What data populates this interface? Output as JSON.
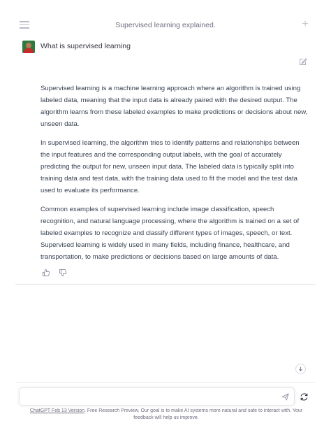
{
  "header": {
    "title": "Supervised learning explained.",
    "menu_icon": "hamburger-menu-icon",
    "new_chat_icon": "plus-icon"
  },
  "user": {
    "avatar_icon": "user-avatar",
    "message": "What is supervised learning"
  },
  "assistant": {
    "paragraphs": [
      "Supervised learning is a machine learning approach where an algorithm is trained using labeled data, meaning that the input data is already paired with the desired output. The algorithm learns from these labeled examples to make predictions or decisions about new, unseen data.",
      "In supervised learning, the algorithm tries to identify patterns and relationships between the input features and the corresponding output labels, with the goal of accurately predicting the output for new, unseen input data. The labeled data is typically split into training data and test data, with the training data used to fit the model and the test data used to evaluate its performance.",
      "Common examples of supervised learning include image classification, speech recognition, and natural language processing, where the algorithm is trained on a set of labeled examples to recognize and classify different types of images, speech, or text. Supervised learning is widely used in many fields, including finance, healthcare, and transportation, to make predictions or decisions based on large amounts of data."
    ]
  },
  "input": {
    "value": "",
    "placeholder": ""
  },
  "footer": {
    "link_text": "ChatGPT Feb 13 Version",
    "text": ". Free Research Preview. Our goal is to make AI systems more natural and safe to interact with. Your feedback will help us improve."
  },
  "colors": {
    "text": "#343541",
    "muted": "#6e6e80",
    "border": "#e5e5e5"
  }
}
